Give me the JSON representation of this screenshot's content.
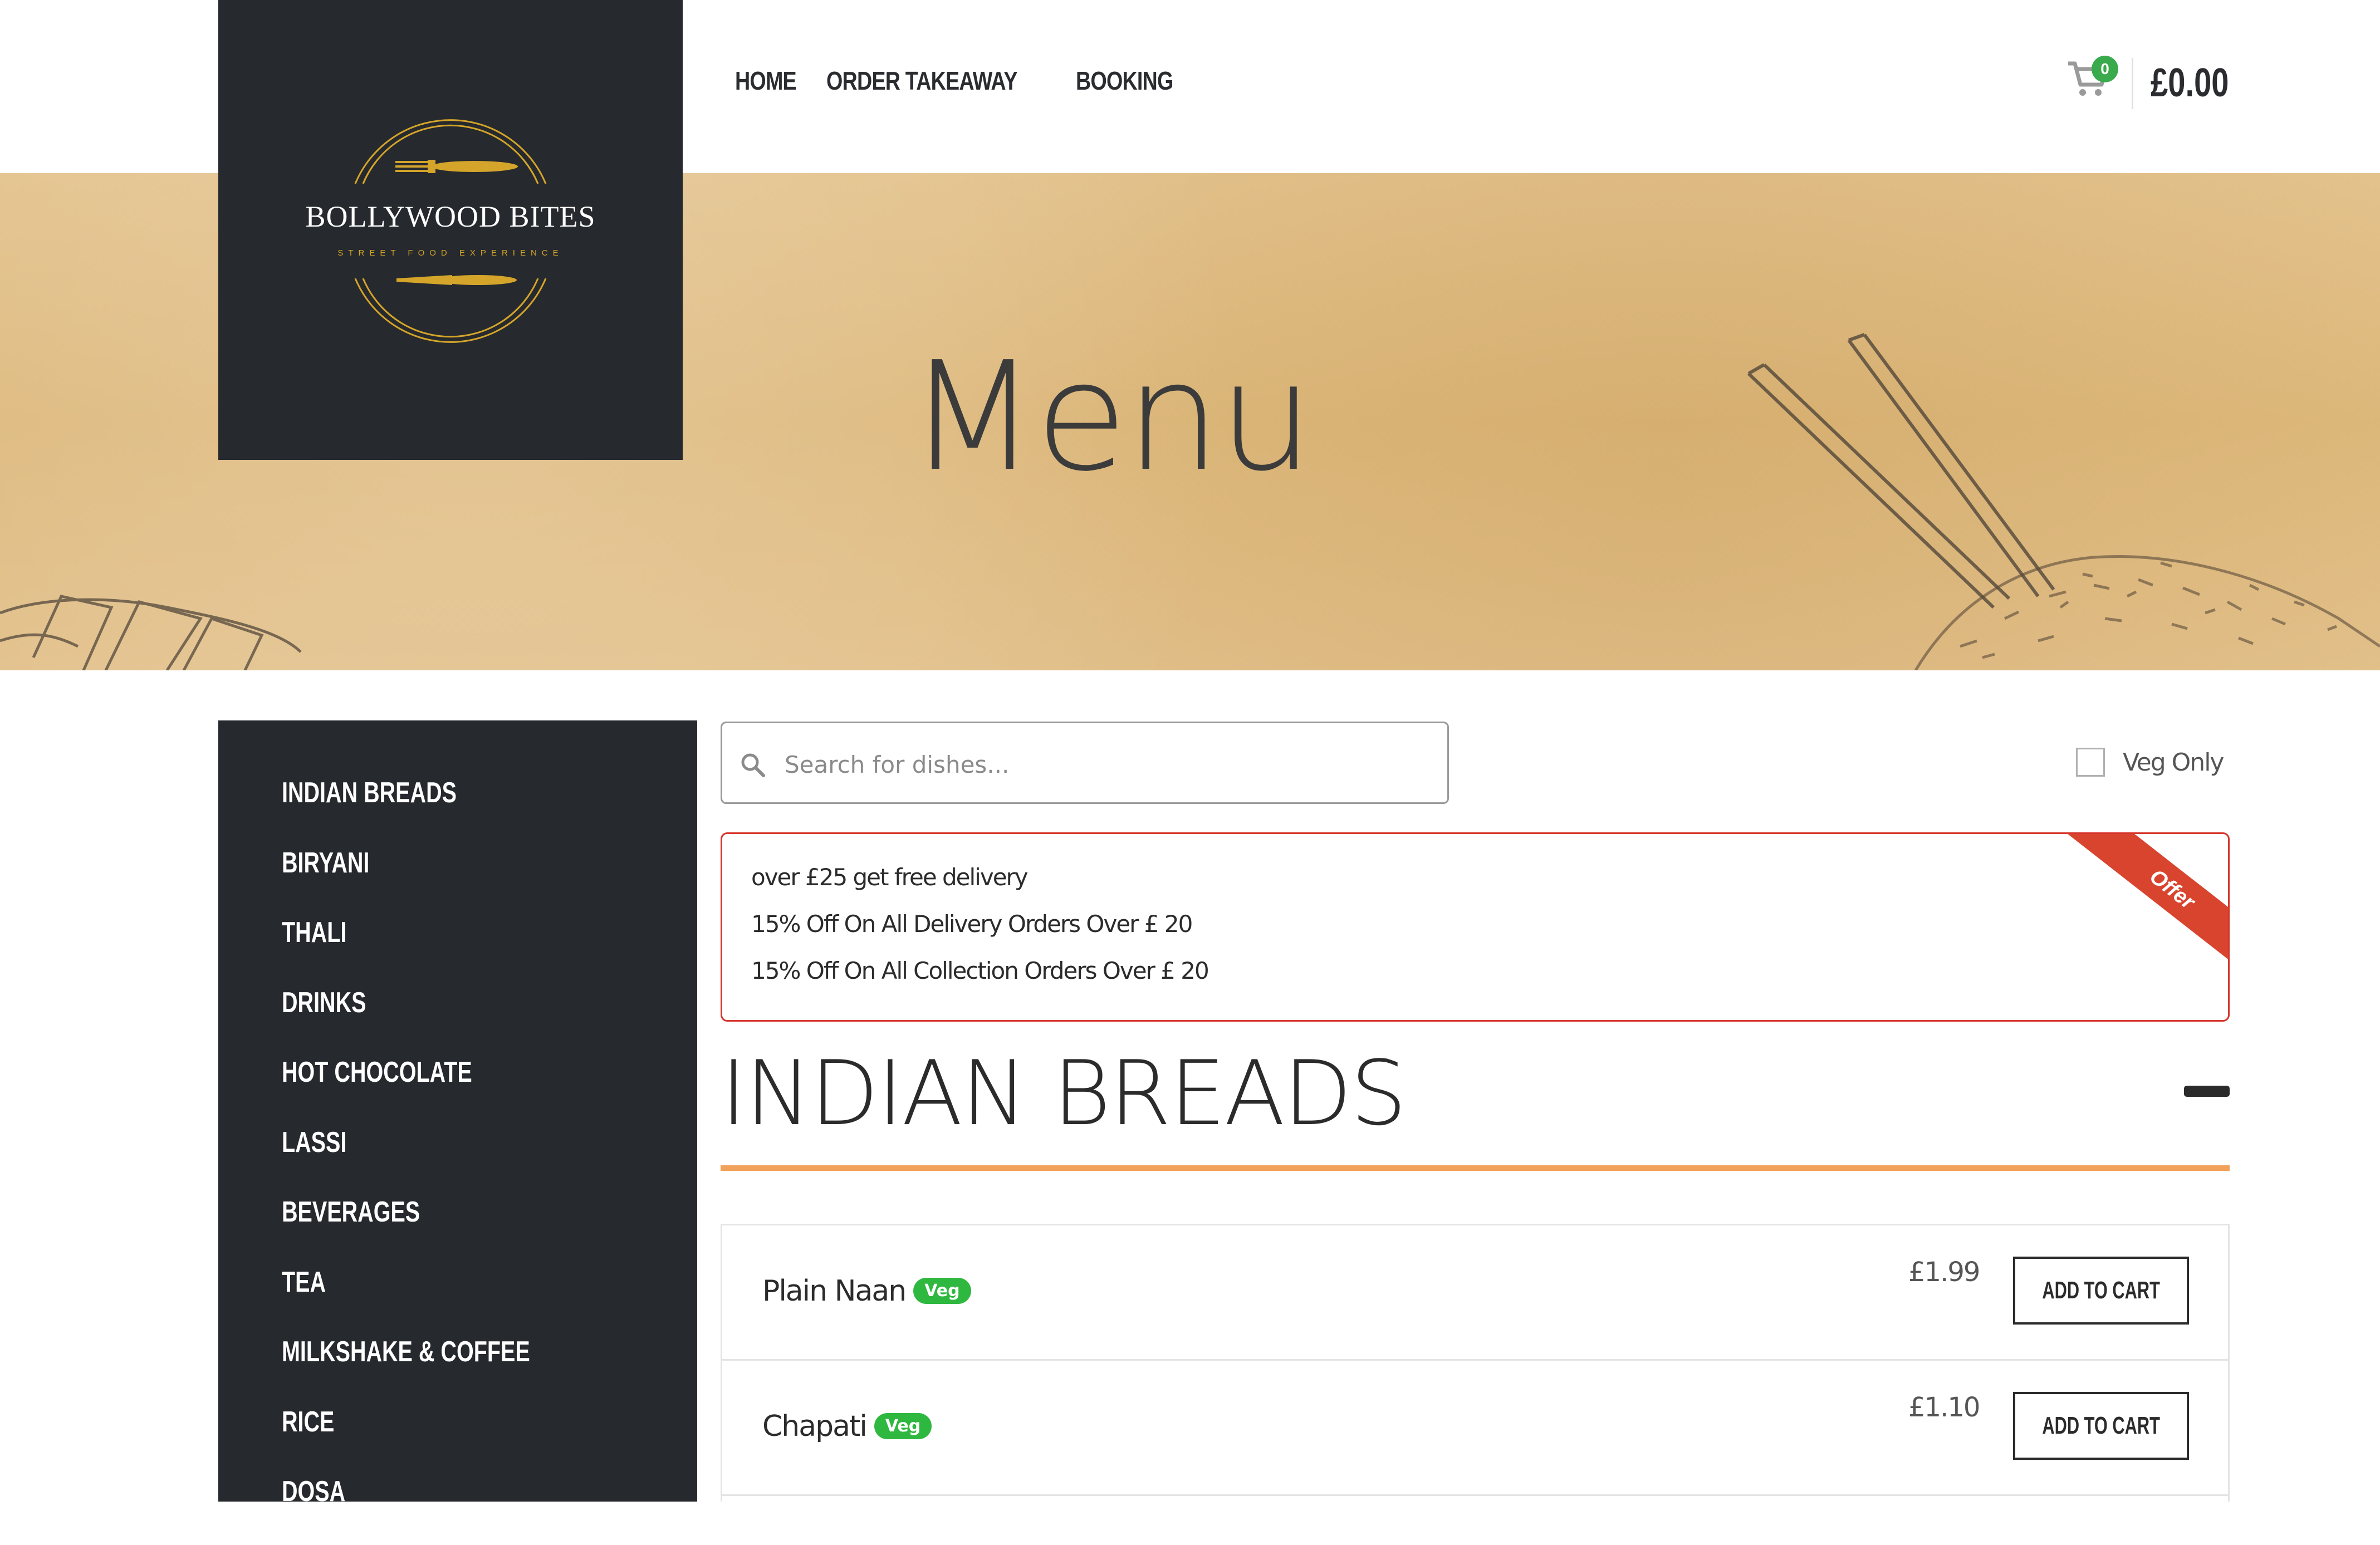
{
  "logo": {
    "name": "BOLLYWOOD BITES",
    "tagline": "STREET FOOD EXPERIENCE"
  },
  "nav": {
    "items": [
      "HOME",
      "ORDER TAKEAWAY",
      "BOOKING"
    ]
  },
  "cart": {
    "count": "0",
    "total": "£0.00",
    "icon": "cart-icon"
  },
  "banner": {
    "title": "Menu"
  },
  "sidebar": {
    "items": [
      "INDIAN BREADS",
      "BIRYANI",
      "THALI",
      "DRINKS",
      "HOT CHOCOLATE",
      "LASSI",
      "BEVERAGES",
      "TEA",
      "MILKSHAKE & COFFEE",
      "RICE",
      "DOSA"
    ]
  },
  "search": {
    "placeholder": "Search for dishes...",
    "icon": "search-icon"
  },
  "filter": {
    "veg_only_label": "Veg Only",
    "checked": false
  },
  "offer": {
    "ribbon": "Offer",
    "lines": [
      "over £25 get free delivery",
      "15% Off On All Delivery Orders Over £ 20",
      "15% Off On All Collection Orders Over £ 20"
    ]
  },
  "section": {
    "title": "INDIAN BREADS"
  },
  "menu_items": [
    {
      "name": "Plain Naan",
      "badge": "Veg",
      "price": "£1.99",
      "button": "ADD TO CART"
    },
    {
      "name": "Chapati",
      "badge": "Veg",
      "price": "£1.10",
      "button": "ADD TO CART"
    }
  ],
  "colors": {
    "dark": "#26292d",
    "accent_orange": "#f2a15a",
    "offer_red": "#d6362c",
    "veg_green": "#2fb83f",
    "cart_badge": "#3aaa4d"
  }
}
